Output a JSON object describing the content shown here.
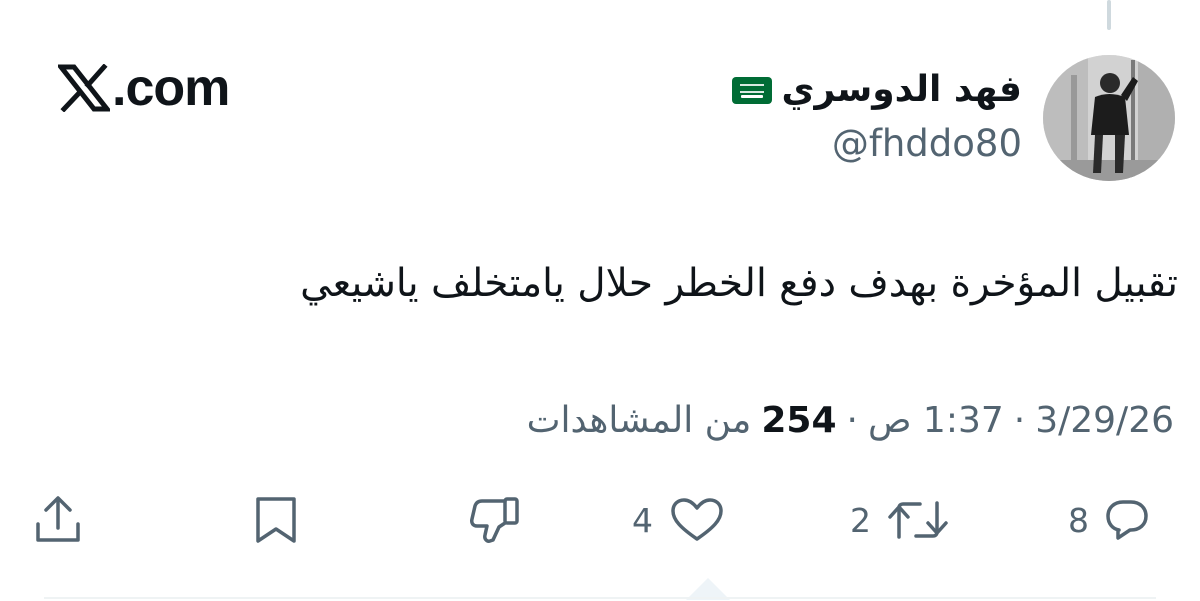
{
  "site": {
    "domain": ".com",
    "logo_icon": "x-logo-icon"
  },
  "author": {
    "display_name": "فهد الدوسري",
    "flag_icon": "saudi-flag-icon",
    "handle": "@fhddo80"
  },
  "tweet": {
    "text": "تقبيل المؤخرة بهدف دفع الخطر حلال يامتخلف ياشيعي"
  },
  "meta": {
    "date": "3/29/26",
    "separator": "·",
    "time": "1:37 ص",
    "views_count": "254",
    "views_label": "من المشاهدات"
  },
  "actions": {
    "reply": {
      "icon": "reply-icon",
      "count": "8"
    },
    "retweet": {
      "icon": "retweet-icon",
      "count": "2"
    },
    "like": {
      "icon": "heart-icon",
      "count": "4"
    },
    "dislike": {
      "icon": "thumbs-down-icon"
    },
    "bookmark": {
      "icon": "bookmark-icon"
    },
    "share": {
      "icon": "share-icon"
    }
  },
  "colors": {
    "text": "#0f1419",
    "secondary": "#536471",
    "flag_green": "#006c35",
    "divider": "#eff3f4"
  }
}
